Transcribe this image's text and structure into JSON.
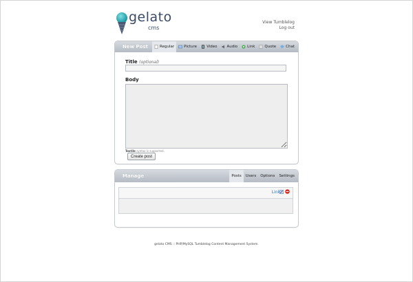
{
  "header": {
    "logo_text": "gelato",
    "logo_sub": "cms",
    "links": [
      "View Tumblelog",
      "Log out"
    ]
  },
  "new_post": {
    "title": "New Post",
    "tabs": [
      {
        "label": "Regular",
        "icon": "page-icon",
        "active": true
      },
      {
        "label": "Picture",
        "icon": "picture-icon",
        "active": false
      },
      {
        "label": "Video",
        "icon": "film-icon",
        "active": false
      },
      {
        "label": "Audio",
        "icon": "speaker-icon",
        "active": false
      },
      {
        "label": "Link",
        "icon": "link-icon",
        "active": false
      },
      {
        "label": "Quote",
        "icon": "quote-icon",
        "active": false
      },
      {
        "label": "Chat",
        "icon": "chat-icon",
        "active": false
      }
    ],
    "title_label": "Title",
    "title_optional": "(optional)",
    "title_value": "",
    "body_label": "Body",
    "body_value": "",
    "textile_bold": "Textile",
    "textile_rest": " syntax is supported.",
    "submit_label": "Create post"
  },
  "manage": {
    "title": "Manage",
    "tabs": [
      {
        "label": "Posts",
        "active": true
      },
      {
        "label": "Users",
        "active": false
      },
      {
        "label": "Options",
        "active": false
      },
      {
        "label": "Settings",
        "active": false
      }
    ],
    "row_link": "Link"
  },
  "footer": "gelato CMS :: PHP/MySQL Tumblelog Content Management System.",
  "colors": {
    "panel_header": "#b5bbc4",
    "logo": "#3a4a63",
    "logo_drop": "#2bb1b8",
    "link": "#3a6fb0",
    "delete": "#d9302a"
  }
}
